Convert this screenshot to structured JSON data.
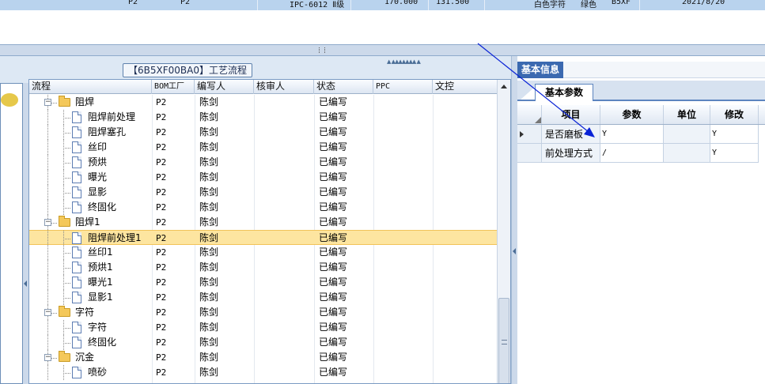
{
  "top_row": {
    "cells": [
      "P2",
      "P2",
      "IPC-6012 Ⅱ级",
      "170.000",
      "131.500",
      "白色字符",
      "绿色",
      "B5XF",
      "2021/8/20"
    ]
  },
  "process_tab": {
    "label": "【6B5XF00BA0】工艺流程"
  },
  "tree_grid": {
    "columns": [
      "流程",
      "BOM工厂",
      "编写人",
      "核审人",
      "状态",
      "PPC",
      "文控"
    ],
    "rows": [
      {
        "name": "阻焊",
        "type": "folder",
        "level": 0,
        "factory": "P2",
        "writer": "陈剑",
        "reviewer": "",
        "status": "已编写"
      },
      {
        "name": "阻焊前处理",
        "type": "doc",
        "level": 1,
        "factory": "P2",
        "writer": "陈剑",
        "reviewer": "",
        "status": "已编写"
      },
      {
        "name": "阻焊塞孔",
        "type": "doc",
        "level": 1,
        "factory": "P2",
        "writer": "陈剑",
        "reviewer": "",
        "status": "已编写"
      },
      {
        "name": "丝印",
        "type": "doc",
        "level": 1,
        "factory": "P2",
        "writer": "陈剑",
        "reviewer": "",
        "status": "已编写"
      },
      {
        "name": "预烘",
        "type": "doc",
        "level": 1,
        "factory": "P2",
        "writer": "陈剑",
        "reviewer": "",
        "status": "已编写"
      },
      {
        "name": "曝光",
        "type": "doc",
        "level": 1,
        "factory": "P2",
        "writer": "陈剑",
        "reviewer": "",
        "status": "已编写"
      },
      {
        "name": "显影",
        "type": "doc",
        "level": 1,
        "factory": "P2",
        "writer": "陈剑",
        "reviewer": "",
        "status": "已编写"
      },
      {
        "name": "终固化",
        "type": "doc",
        "level": 1,
        "factory": "P2",
        "writer": "陈剑",
        "reviewer": "",
        "status": "已编写"
      },
      {
        "name": "阻焊1",
        "type": "folder",
        "level": 0,
        "factory": "P2",
        "writer": "陈剑",
        "reviewer": "",
        "status": "已编写"
      },
      {
        "name": "阻焊前处理1",
        "type": "doc",
        "level": 1,
        "factory": "P2",
        "writer": "陈剑",
        "reviewer": "",
        "status": "已编写",
        "selected": true
      },
      {
        "name": "丝印1",
        "type": "doc",
        "level": 1,
        "factory": "P2",
        "writer": "陈剑",
        "reviewer": "",
        "status": "已编写"
      },
      {
        "name": "预烘1",
        "type": "doc",
        "level": 1,
        "factory": "P2",
        "writer": "陈剑",
        "reviewer": "",
        "status": "已编写"
      },
      {
        "name": "曝光1",
        "type": "doc",
        "level": 1,
        "factory": "P2",
        "writer": "陈剑",
        "reviewer": "",
        "status": "已编写"
      },
      {
        "name": "显影1",
        "type": "doc",
        "level": 1,
        "factory": "P2",
        "writer": "陈剑",
        "reviewer": "",
        "status": "已编写"
      },
      {
        "name": "字符",
        "type": "folder",
        "level": 0,
        "factory": "P2",
        "writer": "陈剑",
        "reviewer": "",
        "status": "已编写"
      },
      {
        "name": "字符",
        "type": "doc",
        "level": 1,
        "factory": "P2",
        "writer": "陈剑",
        "reviewer": "",
        "status": "已编写"
      },
      {
        "name": "终固化",
        "type": "doc",
        "level": 1,
        "factory": "P2",
        "writer": "陈剑",
        "reviewer": "",
        "status": "已编写"
      },
      {
        "name": "沉金",
        "type": "folder",
        "level": 0,
        "factory": "P2",
        "writer": "陈剑",
        "reviewer": "",
        "status": "已编写"
      },
      {
        "name": "喷砂",
        "type": "doc",
        "level": 1,
        "factory": "P2",
        "writer": "陈剑",
        "reviewer": "",
        "status": "已编写"
      }
    ]
  },
  "right_panel": {
    "title": "基本信息",
    "subtab": "基本参数",
    "columns": [
      "项目",
      "参数",
      "单位",
      "修改"
    ],
    "rows": [
      {
        "item": "是否磨板",
        "param": "Y",
        "unit": "",
        "modify": "Y"
      },
      {
        "item": "前处理方式",
        "param": "/",
        "unit": "",
        "modify": "Y"
      }
    ]
  },
  "colors": {
    "panel_blue": "#3b69b0",
    "selection": "#fde5a0",
    "annotation_arrow": "#0a23d6"
  }
}
